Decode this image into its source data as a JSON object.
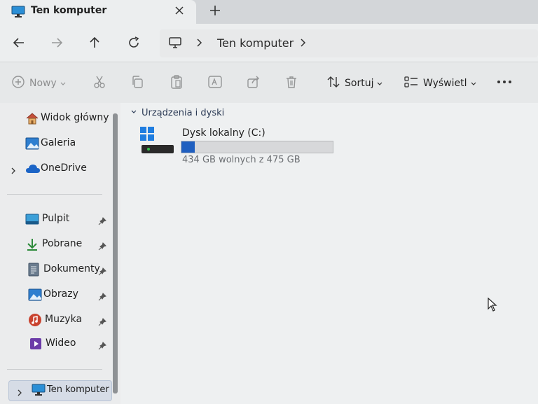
{
  "window": {
    "tab_title": "Ten komputer"
  },
  "address": {
    "location": "Ten komputer"
  },
  "toolbar": {
    "new_label": "Nowy",
    "sort_label": "Sortuj",
    "view_label": "Wyświetl"
  },
  "sidebar": {
    "top": [
      {
        "label": "Widok główny",
        "icon": "home-icon"
      },
      {
        "label": "Galeria",
        "icon": "gallery-icon"
      },
      {
        "label": "OneDrive",
        "icon": "cloud-icon"
      }
    ],
    "pinned": [
      {
        "label": "Pulpit",
        "icon": "desktop-icon"
      },
      {
        "label": "Pobrane",
        "icon": "download-icon"
      },
      {
        "label": "Dokumenty",
        "icon": "documents-icon"
      },
      {
        "label": "Obrazy",
        "icon": "pictures-icon"
      },
      {
        "label": "Muzyka",
        "icon": "music-icon"
      },
      {
        "label": "Wideo",
        "icon": "video-icon"
      }
    ],
    "this_pc": {
      "label": "Ten komputer",
      "icon": "computer-icon"
    }
  },
  "content": {
    "group_title": "Urządzenia i dyski",
    "drives": [
      {
        "name": "Dysk lokalny (C:)",
        "free_text": "434 GB wolnych z 475 GB",
        "used_fraction": 0.086
      }
    ]
  },
  "colors": {
    "accent": "#1f5fc0",
    "selected_bg": "#d6dce6"
  }
}
